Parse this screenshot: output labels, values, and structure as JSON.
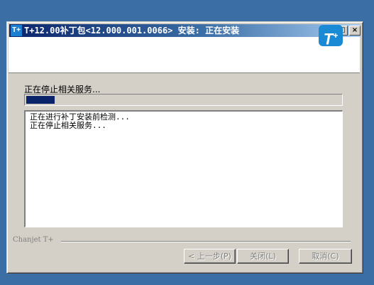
{
  "window": {
    "title": "T+12.00补丁包<12.000.001.0066> 安装: 正在安装",
    "icon_label": "T+",
    "caption_buttons": {
      "minimize": "_",
      "maximize": "□",
      "close": "×"
    }
  },
  "header": {
    "logo_text": "T",
    "logo_sup": "+"
  },
  "status": {
    "label": "正在停止相关服务...",
    "progress_fraction": 0.09
  },
  "log": {
    "lines": [
      "正在进行补丁安装前检测...",
      "正在停止相关服务..."
    ]
  },
  "footer": {
    "brand": "Chanjet T+",
    "buttons": {
      "prev": "< 上一步(P)",
      "close": "关闭(L)",
      "cancel": "取消(C)"
    }
  },
  "colors": {
    "desktop": "#3a6ea5",
    "title_start": "#0a246a",
    "window_face": "#d4d0c8",
    "progress_fill": "#0a246a",
    "logo": "#1a8ad4"
  }
}
